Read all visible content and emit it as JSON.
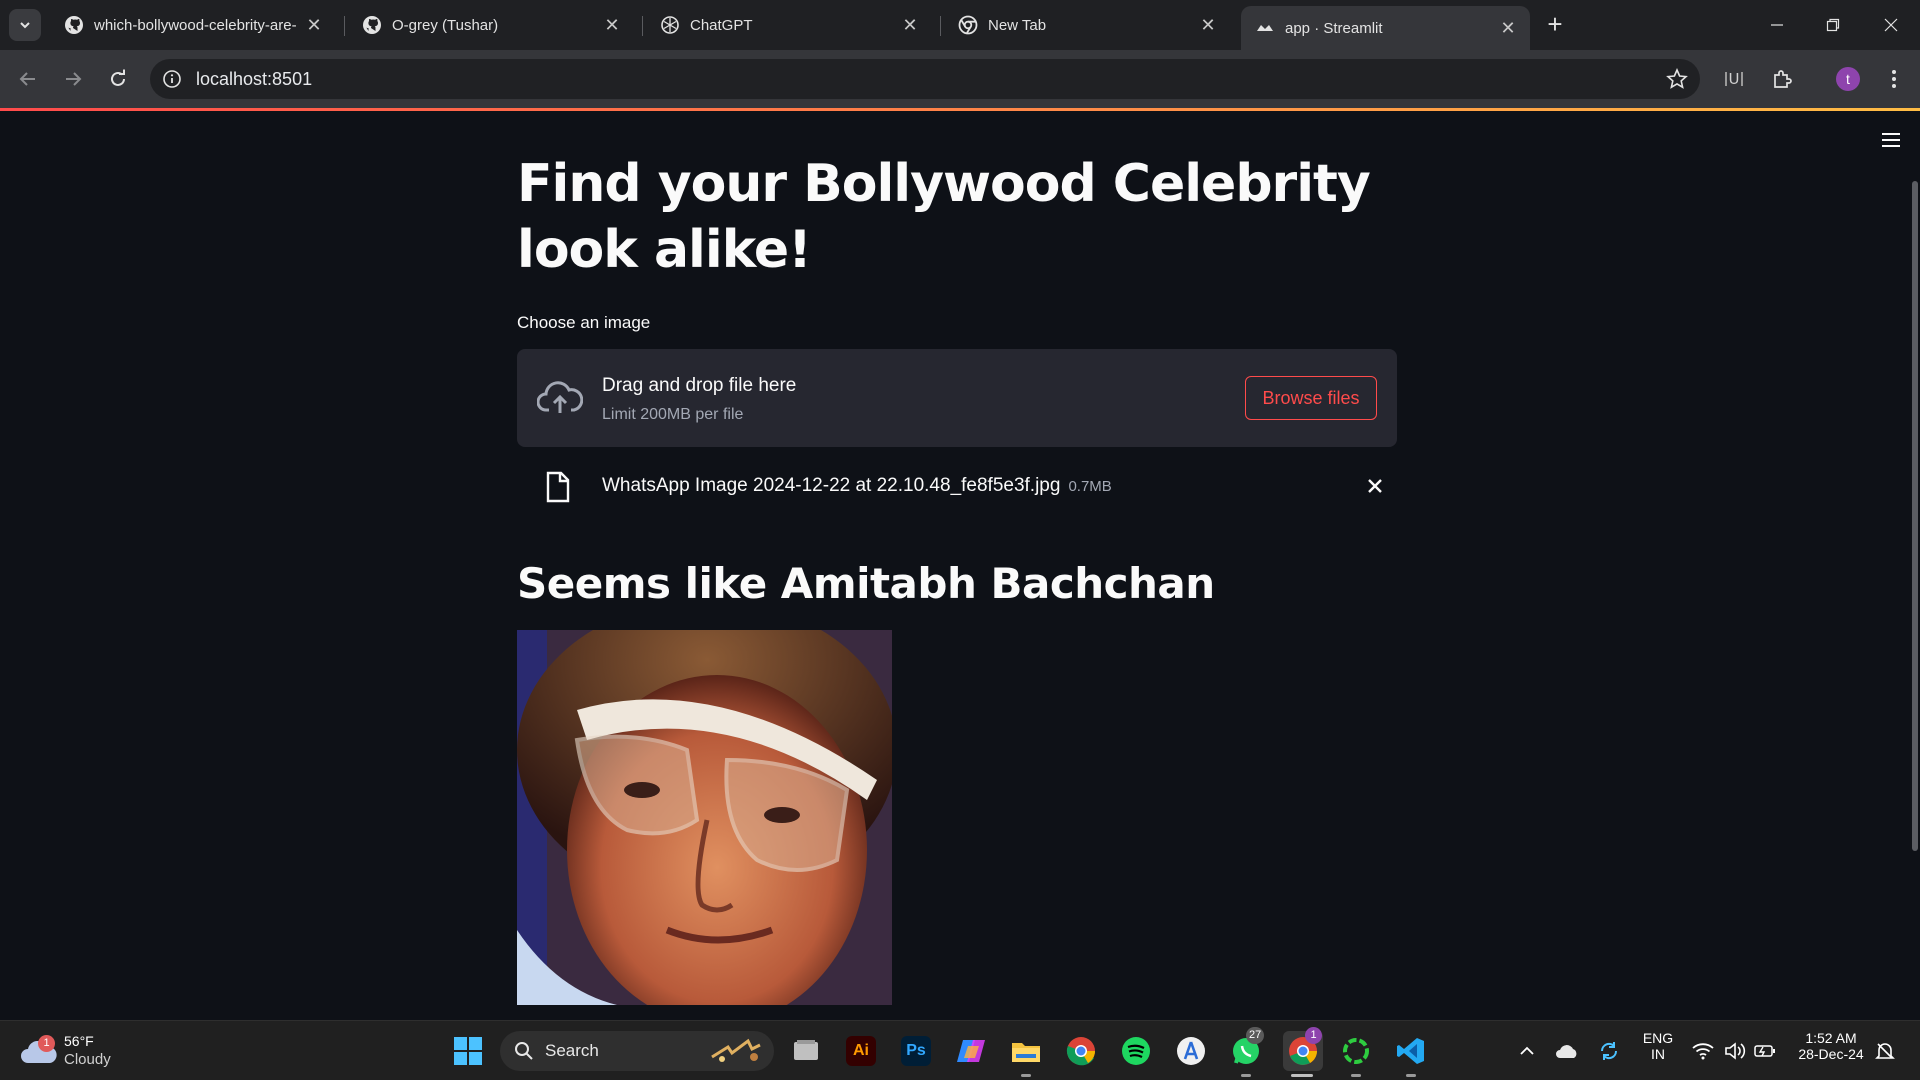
{
  "browser": {
    "tabs": [
      {
        "title": "which-bollywood-celebrity-are-",
        "icon": "github-icon"
      },
      {
        "title": "O-grey (Tushar)",
        "icon": "github-icon"
      },
      {
        "title": "ChatGPT",
        "icon": "chatgpt-icon"
      },
      {
        "title": "New Tab",
        "icon": "chrome-icon"
      },
      {
        "title": "app · Streamlit",
        "icon": "streamlit-icon"
      }
    ],
    "active_tab_index": 4,
    "url": "localhost:8501",
    "profile_initial": "t",
    "extension_label": "U",
    "colors": {
      "tabbar": "#1f2023",
      "toolbar": "#35363a",
      "accent_profile": "#8e44ad"
    }
  },
  "app": {
    "title": "Find your Bollywood Celebrity look alike!",
    "uploader_label": "Choose an image",
    "dropzone_title": "Drag and drop file here",
    "dropzone_limit": "Limit 200MB per file",
    "browse_button": "Browse files",
    "uploaded_file": {
      "name": "WhatsApp Image 2024-12-22 at 22.10.48_fe8f5e3f.jpg",
      "size": "0.7MB"
    },
    "result_heading": "Seems like Amitabh Bachchan",
    "colors": {
      "background": "#0e1117",
      "primary": "#ff4b4b",
      "dropzone": "#262730"
    }
  },
  "taskbar": {
    "weather": {
      "temp": "56°F",
      "condition": "Cloudy",
      "badge": "1"
    },
    "search_placeholder": "Search",
    "apps": [
      {
        "name": "file-manager-icon"
      },
      {
        "name": "illustrator-icon",
        "label": "Ai"
      },
      {
        "name": "photoshop-icon",
        "label": "Ps"
      },
      {
        "name": "copilot-icon"
      },
      {
        "name": "file-explorer-icon"
      },
      {
        "name": "chrome-icon"
      },
      {
        "name": "spotify-icon"
      },
      {
        "name": "app-store-icon"
      },
      {
        "name": "whatsapp-icon",
        "badge": "27"
      },
      {
        "name": "chrome-profile-icon",
        "badge": "1"
      },
      {
        "name": "loader-app-icon"
      },
      {
        "name": "vscode-icon"
      }
    ],
    "language": {
      "line1": "ENG",
      "line2": "IN"
    },
    "clock": {
      "time": "1:52 AM",
      "date": "28-Dec-24"
    }
  }
}
